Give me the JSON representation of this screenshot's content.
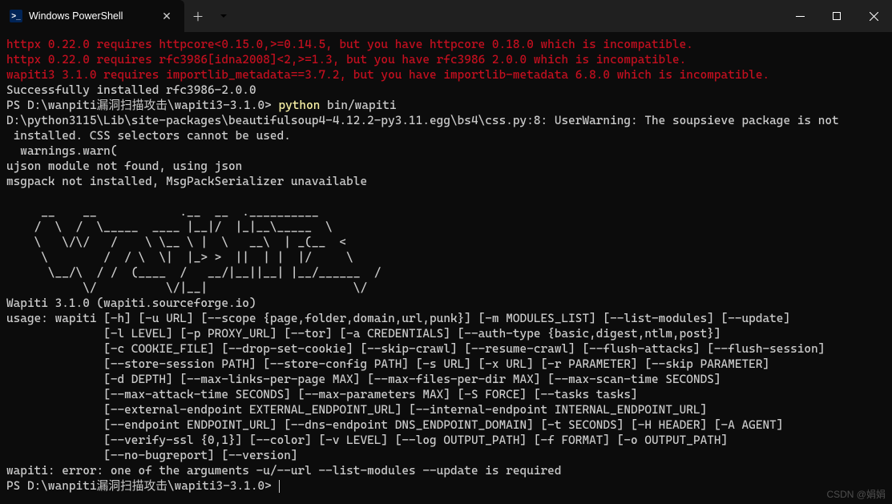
{
  "tab": {
    "title": "Windows PowerShell",
    "icon_glyph": ">_"
  },
  "warnings": [
    "httpx 0.22.0 requires httpcore<0.15.0,>=0.14.5, but you have httpcore 0.18.0 which is incompatible.",
    "httpx 0.22.0 requires rfc3986[idna2008]<2,>=1.3, but you have rfc3986 2.0.0 which is incompatible.",
    "wapiti3 3.1.0 requires importlib_metadata==3.7.2, but you have importlib-metadata 6.8.0 which is incompatible."
  ],
  "install_success": "Successfully installed rfc3986-2.0.0",
  "prompt1_prefix": "PS D:\\wanpiti漏洞扫描攻击\\wapiti3-3.1.0> ",
  "prompt1_cmd": "python",
  "prompt1_args": " bin/wapiti",
  "py_warning_line1": "D:\\python3115\\Lib\\site-packages\\beautifulsoup4-4.12.2-py3.11.egg\\bs4\\css.py:8: UserWarning: The soupsieve package is not",
  "py_warning_line2": " installed. CSS selectors cannot be used.",
  "py_warning_line3": "  warnings.warn(",
  "ujson_line": "ujson module not found, using json",
  "msgpack_line": "msgpack not installed, MsgPackSerializer unavailable",
  "ascii_art": [
    "     __    __            .__  __  .__________",
    "    /  \\  /  \\_____  ____ |__|/  |_|__\\_____  \\",
    "    \\   \\/\\/   /    \\ \\__ \\ |  \\   __\\  | _(__  <",
    "     \\        /  / \\  \\|  |_> >  ||  | |  |/     \\",
    "      \\__/\\  / /  (____  /   __/|__||__| |__/______  /",
    "           \\/          \\/|__|                     \\/"
  ],
  "wapiti_version": "Wapiti 3.1.0 (wapiti.sourceforge.io)",
  "usage": [
    "usage: wapiti [-h] [-u URL] [--scope {page,folder,domain,url,punk}] [-m MODULES_LIST] [--list-modules] [--update]",
    "              [-l LEVEL] [-p PROXY_URL] [--tor] [-a CREDENTIALS] [--auth-type {basic,digest,ntlm,post}]",
    "              [-c COOKIE_FILE] [--drop-set-cookie] [--skip-crawl] [--resume-crawl] [--flush-attacks] [--flush-session]",
    "              [--store-session PATH] [--store-config PATH] [-s URL] [-x URL] [-r PARAMETER] [--skip PARAMETER]",
    "              [-d DEPTH] [--max-links-per-page MAX] [--max-files-per-dir MAX] [--max-scan-time SECONDS]",
    "              [--max-attack-time SECONDS] [--max-parameters MAX] [-S FORCE] [--tasks tasks]",
    "              [--external-endpoint EXTERNAL_ENDPOINT_URL] [--internal-endpoint INTERNAL_ENDPOINT_URL]",
    "              [--endpoint ENDPOINT_URL] [--dns-endpoint DNS_ENDPOINT_DOMAIN] [-t SECONDS] [-H HEADER] [-A AGENT]",
    "              [--verify-ssl {0,1}] [--color] [-v LEVEL] [--log OUTPUT_PATH] [-f FORMAT] [-o OUTPUT_PATH]",
    "              [--no-bugreport] [--version]"
  ],
  "error_line": "wapiti: error: one of the arguments -u/--url --list-modules --update is required",
  "prompt2": "PS D:\\wanpiti漏洞扫描攻击\\wapiti3-3.1.0> ",
  "watermark": "CSDN @娟娟"
}
